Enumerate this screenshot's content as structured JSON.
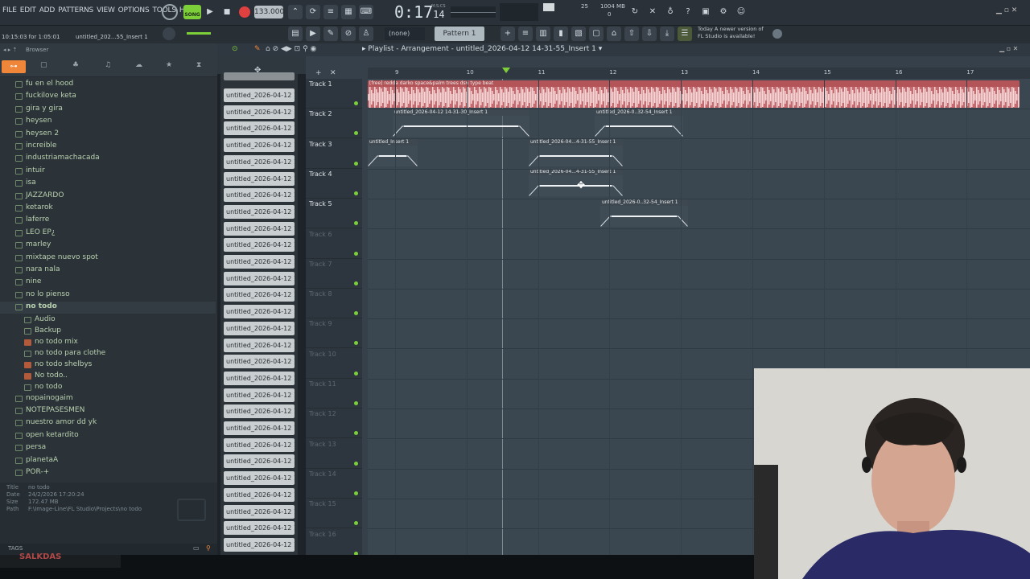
{
  "menu": [
    "FILE",
    "EDIT",
    "ADD",
    "PATTERNS",
    "VIEW",
    "OPTIONS",
    "TOOLS",
    "HELP"
  ],
  "song_mode": "SONG",
  "tempo": "133.000",
  "time_display": "0:17",
  "time_frac": "14",
  "time_unit": "M:S:CS",
  "cpu": "25",
  "memory": "1004 MB",
  "voices": "0",
  "status_time": "10:15:03 for 1:05:01",
  "status_project": "untitled_202...55_Insert 1",
  "snap": "(none)",
  "pattern": "Pattern 1",
  "news": {
    "line1": "Today  A newer version of",
    "line2": "FL Studio is available!"
  },
  "browser": {
    "title": "Browser",
    "items": [
      {
        "label": "fu en el hood",
        "type": "folder",
        "indent": 0
      },
      {
        "label": "fuckilove keta",
        "type": "folder",
        "indent": 0
      },
      {
        "label": "gira y gira",
        "type": "folder",
        "indent": 0
      },
      {
        "label": "heysen",
        "type": "folder",
        "indent": 0
      },
      {
        "label": "heysen 2",
        "type": "folder",
        "indent": 0
      },
      {
        "label": "increible",
        "type": "folder",
        "indent": 0
      },
      {
        "label": "industriamachacada",
        "type": "folder",
        "indent": 0
      },
      {
        "label": "intuir",
        "type": "folder",
        "indent": 0
      },
      {
        "label": "isa",
        "type": "folder",
        "indent": 0
      },
      {
        "label": "JAZZARDO",
        "type": "folder",
        "indent": 0
      },
      {
        "label": "ketarok",
        "type": "folder",
        "indent": 0
      },
      {
        "label": "laferre",
        "type": "folder",
        "indent": 0
      },
      {
        "label": "LEO EP¿",
        "type": "folder",
        "indent": 0
      },
      {
        "label": "marley",
        "type": "folder",
        "indent": 0
      },
      {
        "label": "mixtape nuevo spot",
        "type": "folder",
        "indent": 0
      },
      {
        "label": "nara nala",
        "type": "folder",
        "indent": 0
      },
      {
        "label": "nine",
        "type": "folder",
        "indent": 0
      },
      {
        "label": "no lo pienso",
        "type": "folder",
        "indent": 0
      },
      {
        "label": "no todo",
        "type": "folder-open",
        "indent": 0
      },
      {
        "label": "Audio",
        "type": "folder",
        "indent": 1
      },
      {
        "label": "Backup",
        "type": "folder",
        "indent": 1
      },
      {
        "label": "no todo mix",
        "type": "audio",
        "indent": 1
      },
      {
        "label": "no todo para clothe",
        "type": "file",
        "indent": 1
      },
      {
        "label": "no todo shelbys",
        "type": "audio",
        "indent": 1
      },
      {
        "label": "No todo..",
        "type": "audio",
        "indent": 1
      },
      {
        "label": "no todo",
        "type": "file",
        "indent": 1
      },
      {
        "label": "nopainogaim",
        "type": "folder",
        "indent": 0
      },
      {
        "label": "NOTEPASESMEN",
        "type": "folder",
        "indent": 0
      },
      {
        "label": "nuestro amor dd yk",
        "type": "folder",
        "indent": 0
      },
      {
        "label": "open ketardito",
        "type": "folder",
        "indent": 0
      },
      {
        "label": "persa",
        "type": "folder",
        "indent": 0
      },
      {
        "label": "planetaA",
        "type": "folder",
        "indent": 0
      },
      {
        "label": "POR-+",
        "type": "folder",
        "indent": 0
      }
    ],
    "info": {
      "title_k": "Title",
      "title_v": "no todo",
      "date_k": "Date",
      "date_v": "24/2/2026 17:20:24",
      "size_k": "Size",
      "size_v": "172.47 MB",
      "path_k": "Path",
      "path_v": "F:\\Image-Line\\FL Studio\\Projects\\no todo"
    },
    "tags_label": "TAGS"
  },
  "channel_label": "untitled_2026-04-12 14-...",
  "playlist": {
    "title": "Playlist - Arrangement",
    "subtitle": "untitled_2026-04-12 14-31-55_Insert 1",
    "ruler": [
      "9",
      "10",
      "11",
      "12",
      "13",
      "14",
      "15",
      "16",
      "17"
    ],
    "tracks": [
      "Track 1",
      "Track 2",
      "Track 3",
      "Track 4",
      "Track 5",
      "Track 6",
      "Track 7",
      "Track 8",
      "Track 9",
      "Track 10",
      "Track 11",
      "Track 12",
      "Track 13",
      "Track 14",
      "Track 15",
      "Track 16"
    ],
    "clips": [
      {
        "label": "[free] redda  darko  space&palm trees  ds6 type beat",
        "track": 1
      },
      {
        "label": "untitled_2026-04-12 14-31-30_Insert 1",
        "track": 2
      },
      {
        "label": "untitled_2026-0..32-54_Insert 1",
        "track": 2
      },
      {
        "label": "untitled_Insert 1",
        "track": 3
      },
      {
        "label": "untitled_2026-04...4-31-55_Insert 1",
        "track": 3
      },
      {
        "label": "untitled_2026-04...4-31-55_Insert 1",
        "track": 4
      },
      {
        "label": "untitled_2026-0..32-54_Insert 1",
        "track": 5
      }
    ]
  },
  "bottom_text": "SALKDAS",
  "colors": {
    "accent": "#f0863a",
    "green": "#7dcf3a",
    "clip_red": "#c2646a",
    "clip_gray": "#48545e"
  }
}
